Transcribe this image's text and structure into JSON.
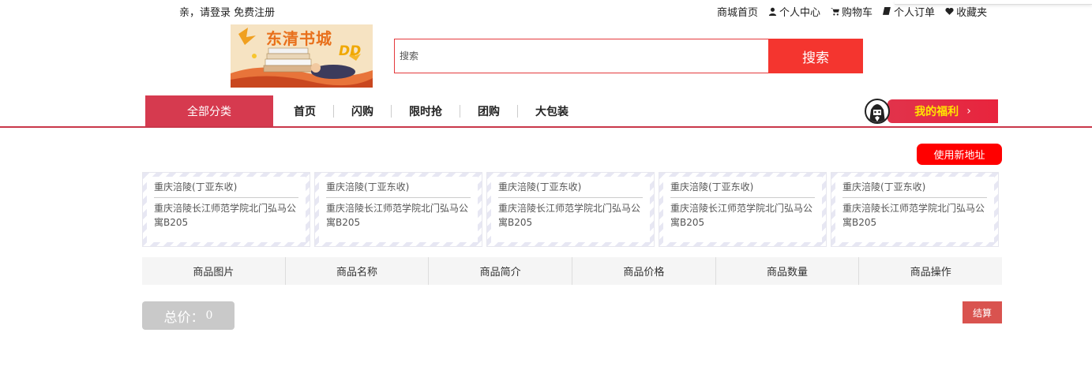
{
  "topbar": {
    "greeting": "亲，请登录",
    "register": "免费注册",
    "links": [
      {
        "label": "商城首页",
        "icon": ""
      },
      {
        "label": "个人中心",
        "icon": "user-icon"
      },
      {
        "label": "购物车",
        "icon": "cart-icon"
      },
      {
        "label": "个人订单",
        "icon": "book-icon"
      },
      {
        "label": "收藏夹",
        "icon": "heart-icon"
      }
    ]
  },
  "logo": {
    "title": "东清书城",
    "sub": "DD"
  },
  "search": {
    "placeholder": "搜索",
    "value": "",
    "button": "搜索"
  },
  "nav": {
    "all_categories": "全部分类",
    "items": [
      "首页",
      "闪购",
      "限时抢",
      "团购",
      "大包装"
    ],
    "welfare": "我的福利",
    "welfare_arrow": "›"
  },
  "address": {
    "new_button": "使用新地址",
    "cards": [
      {
        "name": "重庆涪陵(丁亚东收)",
        "detail": "重庆涪陵长江师范学院北门弘马公寓B205"
      },
      {
        "name": "重庆涪陵(丁亚东收)",
        "detail": "重庆涪陵长江师范学院北门弘马公寓B205"
      },
      {
        "name": "重庆涪陵(丁亚东收)",
        "detail": "重庆涪陵长江师范学院北门弘马公寓B205"
      },
      {
        "name": "重庆涪陵(丁亚东收)",
        "detail": "重庆涪陵长江师范学院北门弘马公寓B205"
      },
      {
        "name": "重庆涪陵(丁亚东收)",
        "detail": "重庆涪陵长江师范学院北门弘马公寓B205"
      }
    ]
  },
  "table": {
    "headers": [
      "商品图片",
      "商品名称",
      "商品简介",
      "商品价格",
      "商品数量",
      "商品操作"
    ]
  },
  "footer": {
    "total_label": "总价：",
    "total_value": "0",
    "checkout": "结算"
  },
  "colors": {
    "accent": "#f4352f",
    "nav_red": "#d63a4f",
    "welfare_text": "#ffe600"
  }
}
